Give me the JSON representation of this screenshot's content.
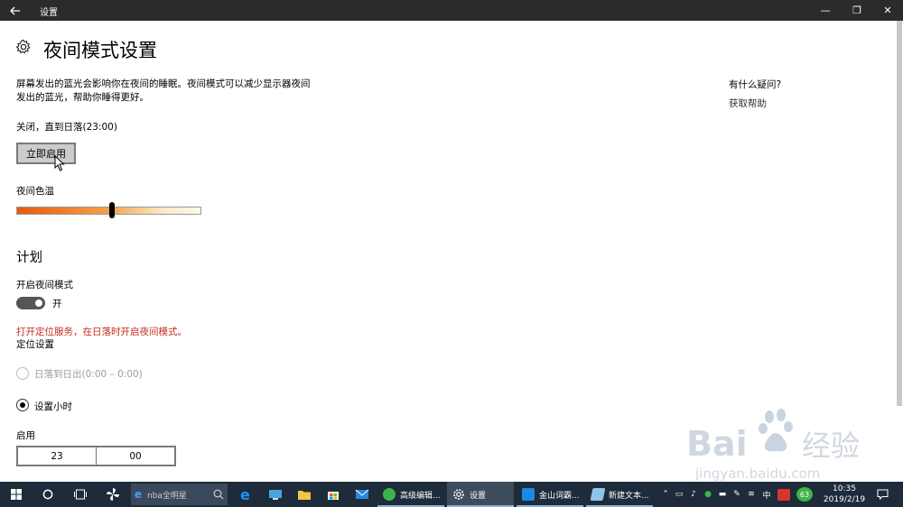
{
  "window": {
    "title": "设置",
    "back_icon": "back-arrow-icon",
    "minimize_glyph": "—",
    "restore_glyph": "❐",
    "close_glyph": "✕"
  },
  "page": {
    "title": "夜间模式设置",
    "description": "屏幕发出的蓝光会影响你在夜间的睡眠。夜间模式可以减少显示器夜间发出的蓝光，帮助你睡得更好。",
    "status": "关闭，直到日落(23:00)",
    "enable_now_button": "立即启用",
    "color_temp_label": "夜间色温",
    "color_temp_level_percent": 52
  },
  "schedule": {
    "heading": "计划",
    "schedule_label": "开启夜间模式",
    "toggle_state": "开",
    "location_warning": "打开定位服务，在日落时开启夜间模式。",
    "location_link": "定位设置",
    "options": [
      {
        "label": "日落到日出(0:00 – 0:00)",
        "selected": false,
        "enabled": false
      },
      {
        "label": "设置小时",
        "selected": true,
        "enabled": true
      }
    ],
    "turn_on_label": "启用",
    "turn_on_hour": "23",
    "turn_on_minute": "00"
  },
  "help": {
    "question": "有什么疑问?",
    "link": "获取帮助"
  },
  "watermark": {
    "brand": "Bai",
    "brand2": "经验",
    "url": "jingyan.baidu.com"
  },
  "taskbar": {
    "search_text": "nba全明星",
    "apps": [
      {
        "label": "高级编辑...",
        "icon": "green-app-icon"
      },
      {
        "label": "设置",
        "icon": "gear-icon"
      },
      {
        "label": "金山词霸...",
        "icon": "dictionary-icon"
      },
      {
        "label": "新建文本...",
        "icon": "notepad-icon"
      }
    ],
    "ime": "中",
    "badge": "63",
    "time": "10:35",
    "date": "2019/2/19"
  },
  "colors": {
    "titlebar": "#2b2b2b",
    "taskbar": "#1d2b3a",
    "warning": "#c42b1c"
  }
}
